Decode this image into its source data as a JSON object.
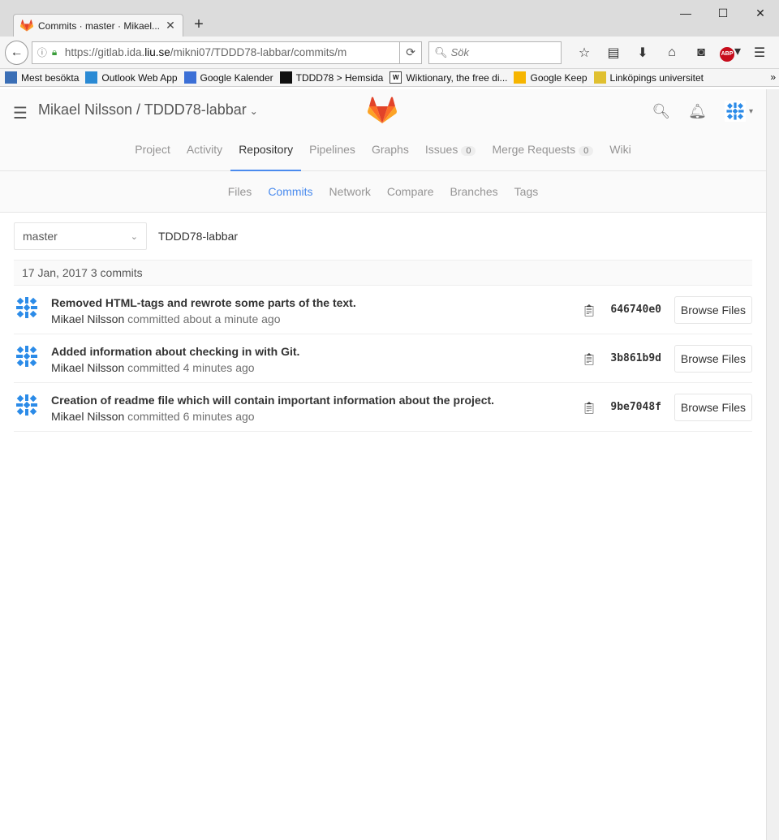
{
  "browser": {
    "tab_title": "Commits · master · Mikael...",
    "url_prefix": "https://gitlab.ida.",
    "url_domain": "liu.se",
    "url_suffix": "/mikni07/TDDD78-labbar/commits/m",
    "search_placeholder": "Sök",
    "bookmarks": [
      {
        "label": "Mest besökta",
        "icon": "folder-icon",
        "color": "#3b6fb6"
      },
      {
        "label": "Outlook Web App",
        "icon": "outlook-icon",
        "color": "#2a8ad4"
      },
      {
        "label": "Google Kalender",
        "icon": "calendar-icon",
        "color": "#3b6fd6"
      },
      {
        "label": "TDDD78 > Hemsida",
        "icon": "liu-icon",
        "color": "#111111"
      },
      {
        "label": "Wiktionary, the free di...",
        "icon": "wiktionary-icon",
        "color": "#ffffff"
      },
      {
        "label": "Google Keep",
        "icon": "keep-icon",
        "color": "#f6b500"
      },
      {
        "label": "Linköpings universitet",
        "icon": "liu-logo-icon",
        "color": "#e0c030"
      }
    ]
  },
  "header": {
    "project_title": "Mikael Nilsson / TDDD78-labbar"
  },
  "nav": [
    {
      "label": "Project",
      "active": false
    },
    {
      "label": "Activity",
      "active": false
    },
    {
      "label": "Repository",
      "active": true
    },
    {
      "label": "Pipelines",
      "active": false
    },
    {
      "label": "Graphs",
      "active": false
    },
    {
      "label": "Issues",
      "active": false,
      "badge": "0"
    },
    {
      "label": "Merge Requests",
      "active": false,
      "badge": "0"
    },
    {
      "label": "Wiki",
      "active": false
    }
  ],
  "subnav": [
    {
      "label": "Files",
      "active": false
    },
    {
      "label": "Commits",
      "active": true
    },
    {
      "label": "Network",
      "active": false
    },
    {
      "label": "Compare",
      "active": false
    },
    {
      "label": "Branches",
      "active": false
    },
    {
      "label": "Tags",
      "active": false
    }
  ],
  "tree": {
    "branch": "master",
    "repo": "TDDD78-labbar"
  },
  "day": {
    "date": "17 Jan, 2017",
    "count": "3 commits"
  },
  "commits": [
    {
      "title": "Removed HTML-tags and rewrote some parts of the text.",
      "author": "Mikael Nilsson",
      "verb": "committed",
      "time": "about a minute ago",
      "sha": "646740e0",
      "button": "Browse Files"
    },
    {
      "title": "Added information about checking in with Git.",
      "author": "Mikael Nilsson",
      "verb": "committed",
      "time": "4 minutes ago",
      "sha": "3b861b9d",
      "button": "Browse Files"
    },
    {
      "title": "Creation of readme file which will contain important information about the project.",
      "author": "Mikael Nilsson",
      "verb": "committed",
      "time": "6 minutes ago",
      "sha": "9be7048f",
      "button": "Browse Files"
    }
  ],
  "colors": {
    "accent": "#4a8bee",
    "gitlab_orange": "#fc6d26",
    "avatar_blue": "#2b8be8"
  }
}
